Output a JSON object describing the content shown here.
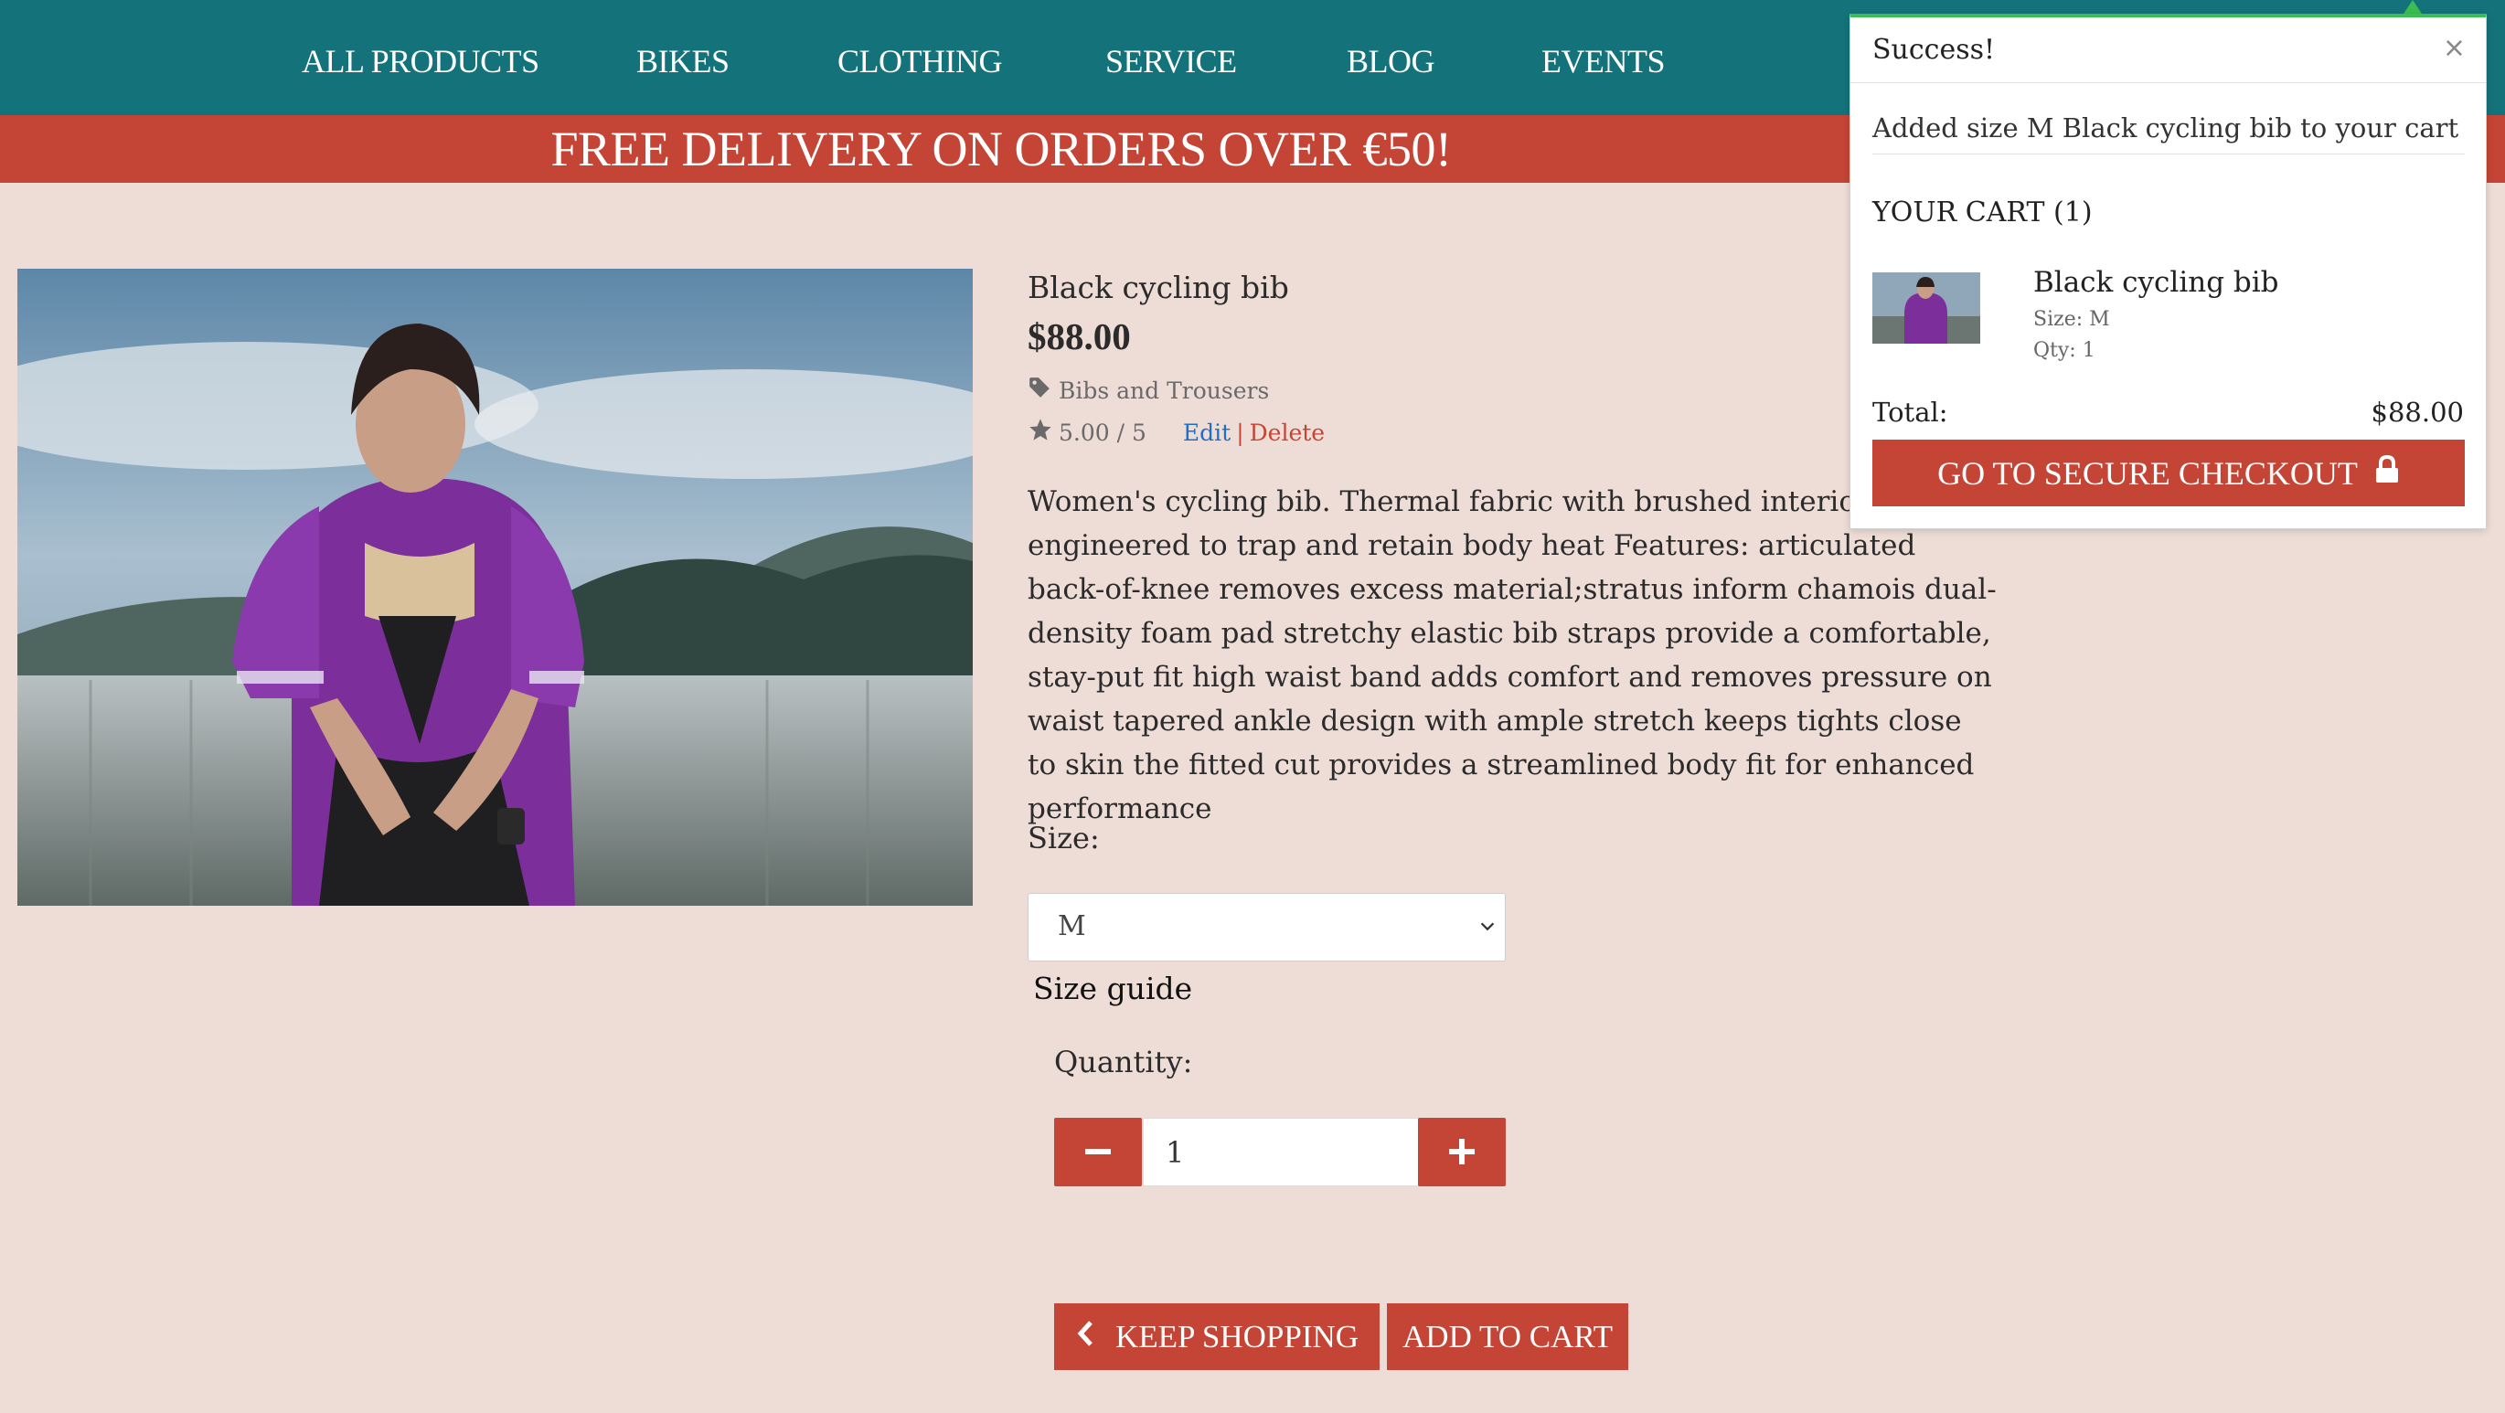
{
  "nav": {
    "items": [
      "ALL PRODUCTS",
      "BIKES",
      "CLOTHING",
      "SERVICE",
      "BLOG",
      "EVENTS"
    ]
  },
  "promo": {
    "text": "FREE DELIVERY ON ORDERS OVER €50!"
  },
  "product": {
    "name": "Black cycling bib",
    "price": "$88.00",
    "category": "Bibs and Trousers",
    "rating": "5.00 / 5",
    "edit_label": "Edit",
    "separator": "|",
    "delete_label": "Delete",
    "description": "Women's cycling bib. Thermal fabric with brushed interior is engineered to trap and retain body heat Features: articulated back-of-knee removes excess material;stratus inform chamois dual-density foam pad stretchy elastic bib straps provide a comfortable, stay-put fit high waist band adds comfort and removes pressure on waist tapered ankle design with ample stretch keeps tights close to skin the fitted cut provides a streamlined body fit for enhanced performance",
    "size_label": "Size:",
    "size_selected": "M",
    "size_guide_label": "Size guide",
    "quantity_label": "Quantity:",
    "quantity_value": "1",
    "keep_shopping_label": "KEEP SHOPPING",
    "add_to_cart_label": "ADD TO CART"
  },
  "toast": {
    "title": "Success!",
    "close": "×",
    "message": "Added size M Black cycling bib to your cart",
    "cart_heading": "YOUR CART (1)",
    "item_name": "Black cycling bib",
    "item_size": "Size: M",
    "item_qty": "Qty: 1",
    "total_label": "Total:",
    "total_value": "$88.00",
    "checkout_label": "GO TO SECURE CHECKOUT"
  },
  "colors": {
    "nav_bg": "#14737a",
    "accent_red": "#c44535",
    "page_bg": "#eeddd6",
    "toast_border": "#3bbd52",
    "link_blue": "#1a6fd0"
  },
  "icons": {
    "category": "tag-icon",
    "rating": "star-icon",
    "select": "chevron-down-icon",
    "minus": "minus-icon",
    "plus": "plus-icon",
    "back": "chevron-left-icon",
    "checkout": "lock-icon"
  }
}
